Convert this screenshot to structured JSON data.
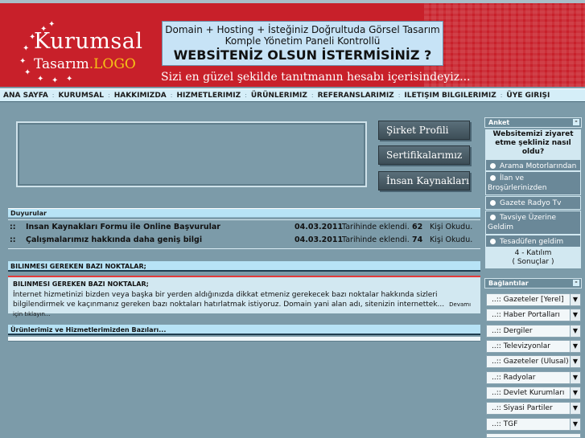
{
  "header": {
    "logo_line1": "Kurumsal",
    "logo_line2": "Tasarım",
    "logo_line3": ".LOGO",
    "promo_line1": "Domain + Hosting + İsteğiniz Doğrultuda Görsel Tasarım",
    "promo_line2": "Komple Yönetim Paneli Kontrollü",
    "promo_line3": "WEBSİTENİZ OLSUN İSTERMİSİNİZ ?",
    "slogan": "Sizi en güzel şekilde tanıtmanın hesabı içerisindeyiz..."
  },
  "menu": [
    "ANA SAYFA",
    "KURUMSAL",
    "HAKKIMIZDA",
    "HIZMETLERIMIZ",
    "ÜRÜNLERIMIZ",
    "REFERANSLARIMIZ",
    "ILETIŞIM BILGILERIMIZ",
    "ÜYE GIRIŞI"
  ],
  "side_buttons": [
    "Şirket Profili",
    "Sertifikalarımız",
    "İnsan Kaynakları"
  ],
  "announcements": {
    "title": "Duyurular",
    "items": [
      {
        "bullet": "::",
        "text": "Insan Kaynakları Formu ile Online Başvurular",
        "date": "04.03.2011",
        "added": "Tarihinde eklendi.",
        "count": "62",
        "read": "Kişi Okudu."
      },
      {
        "bullet": "::",
        "text": "Çalışmalarımız hakkında daha geniş bilgi",
        "date": "04.03.2011",
        "added": "Tarihinde eklendi.",
        "count": "74",
        "read": "Kişi Okudu."
      }
    ]
  },
  "notes": {
    "title": "BILINMESI GEREKEN BAZI NOKTALAR;",
    "inner_title": "BILINMESI GEREKEN BAZI NOKTALAR;",
    "body": "İnternet hizmetinizi bizden veya başka bir yerden aldığınızda dikkat etmeniz gerekecek bazı noktalar hakkında sizleri bilgilendirmek ve kaçınmanız gereken bazı noktaları hatırlatmak istiyoruz.  Domain yani alan adı, sitenizin internettek...",
    "more": "Devamı için tıklayın..."
  },
  "products": {
    "title": "Ürünlerimiz ve Hizmetlerimizden Bazıları..."
  },
  "poll": {
    "title": "Anket",
    "min_label": "-",
    "question": "Websitemizi ziyaret etme şekliniz nasıl oldu?",
    "options": [
      "Arama Motorlarından",
      "İlan ve Broşürlerinizden",
      "Gazete Radyo Tv",
      "Tavsiye Üzerine Geldim",
      "Tesadüfen geldim"
    ],
    "participants": "4 - Katılım",
    "results": "( Sonuçlar )"
  },
  "links": {
    "title": "Bağlantılar",
    "min_label": "-",
    "items": [
      "..:: Gazeteler [Yerel]",
      "..:: Haber Portalları",
      "..:: Dergiler",
      "..:: Televizyonlar",
      "..:: Gazeteler (Ulusal)",
      "..:: Radyolar",
      "..:: Devlet Kurumları",
      "..:: Siyasi Partiler",
      "..:: TGF"
    ],
    "arrow": "▼"
  }
}
